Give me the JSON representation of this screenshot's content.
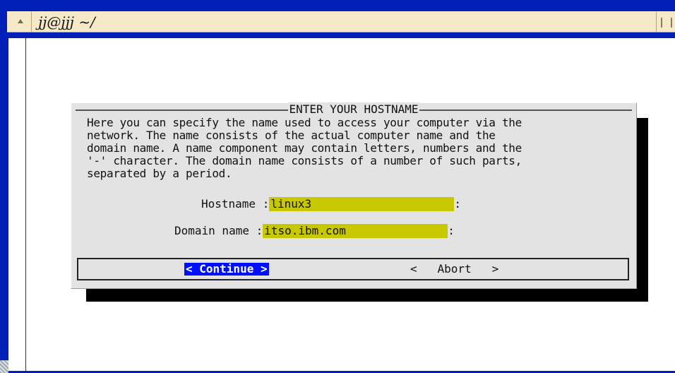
{
  "window": {
    "title": "jj@jjj ~/"
  },
  "dialog": {
    "title": "ENTER YOUR HOSTNAME",
    "description_lines": [
      "Here you can specify the name used to access your computer via the",
      "network. The name consists of the actual computer name and the",
      "domain name. A name component may contain letters, numbers and the",
      "'-' character. The domain name consists of a number of such parts,",
      "separated by a period."
    ],
    "fields": {
      "hostname": {
        "label": "Hostname :",
        "value": "linux3",
        "suffix": ":"
      },
      "domain": {
        "label": "Domain name :",
        "value": "itso.ibm.com",
        "suffix": ":"
      }
    },
    "buttons": {
      "continue": "< Continue >",
      "abort": "<   Abort   >"
    }
  },
  "colors": {
    "frame": "#0020b8",
    "dialog_bg": "#e3e3e3",
    "input_bg": "#c8c800",
    "selected_button_bg": "#0010ff"
  }
}
